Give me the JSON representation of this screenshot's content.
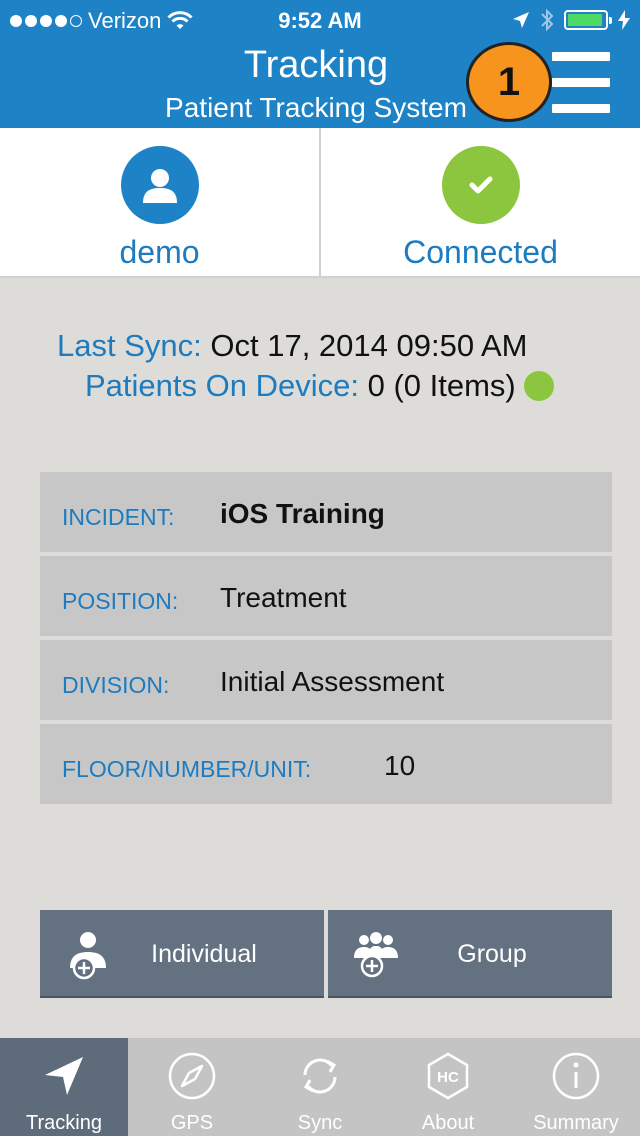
{
  "status_bar": {
    "carrier": "Verizon",
    "time": "9:52 AM"
  },
  "header": {
    "title": "Tracking",
    "subtitle": "Patient Tracking System",
    "badge": "1"
  },
  "tiles": {
    "user_label": "demo",
    "connection_label": "Connected"
  },
  "sync": {
    "last_sync_label": "Last Sync:",
    "last_sync_value": "Oct 17, 2014 09:50 AM",
    "patients_label": "Patients On Device:",
    "patients_value": "0 (0 Items)"
  },
  "fields": {
    "incident_label": "INCIDENT:",
    "incident_value": "iOS Training",
    "position_label": "POSITION:",
    "position_value": "Treatment",
    "division_label": "DIVISION:",
    "division_value": "Initial Assessment",
    "floor_label": "FLOOR/NUMBER/UNIT:",
    "floor_value": "10"
  },
  "actions": {
    "individual_label": "Individual",
    "group_label": "Group"
  },
  "tabs": [
    {
      "label": "Tracking",
      "icon": "navigation-arrow-icon",
      "active": true
    },
    {
      "label": "GPS",
      "icon": "compass-icon",
      "active": false
    },
    {
      "label": "Sync",
      "icon": "sync-icon",
      "active": false
    },
    {
      "label": "About",
      "icon": "hc-logo-icon",
      "active": false
    },
    {
      "label": "Summary",
      "icon": "info-icon",
      "active": false
    }
  ],
  "colors": {
    "header_blue": "#1d82c6",
    "accent_green": "#8cc63f",
    "badge_orange": "#f7941d",
    "action_slate": "#637181"
  }
}
